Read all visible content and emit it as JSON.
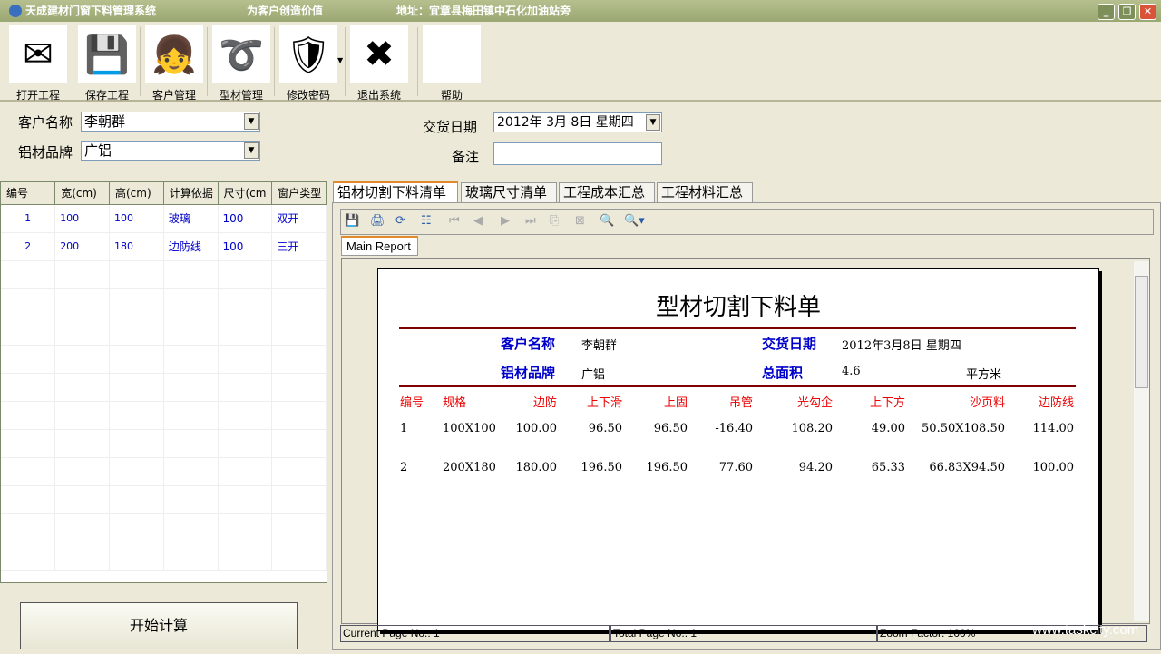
{
  "window": {
    "title": "天成建材门窗下料管理系统",
    "slogan": "为客户创造价值",
    "address": "地址：宜章县梅田镇中石化加油站旁",
    "minimize": "_",
    "restore": "❐",
    "close": "✕"
  },
  "toolbar": [
    {
      "label": "打开工程",
      "icon": "open-project-icon",
      "glyph": "✉"
    },
    {
      "label": "保存工程",
      "icon": "save-floppy-icon",
      "glyph": "💾"
    },
    {
      "label": "客户管理",
      "icon": "customer-avatar-icon",
      "glyph": "👧"
    },
    {
      "label": "型材管理",
      "icon": "profile-knot-icon",
      "glyph": "➰"
    },
    {
      "label": "修改密码",
      "icon": "shield-icon",
      "glyph": "🛡"
    },
    {
      "label": "退出系统",
      "icon": "exit-x-icon",
      "glyph": "✖"
    },
    {
      "label": "帮助",
      "icon": "help-icon",
      "glyph": "help"
    }
  ],
  "form": {
    "customer_label": "客户名称",
    "customer_value": "李朝群",
    "brand_label": "铝材品牌",
    "brand_value": "广铝",
    "date_label": "交货日期",
    "date_value": "2012年  3月  8日  星期四",
    "note_label": "备注",
    "note_value": ""
  },
  "grid": {
    "columns": [
      "编号",
      "宽(cm)",
      "高(cm)",
      "计算依据",
      "尺寸(cm",
      "窗户类型"
    ],
    "rows": [
      [
        "1",
        "100",
        "100",
        "玻璃",
        "100",
        "双开"
      ],
      [
        "2",
        "200",
        "180",
        "边防线",
        "100",
        "三开"
      ]
    ]
  },
  "calc_button": "开始计算",
  "tabs": [
    "铝材切割下料清单",
    "玻璃尺寸清单",
    "工程成本汇总",
    "工程材料汇总"
  ],
  "report_tab": "Main Report",
  "report": {
    "title": "型材切割下料单",
    "customer_label": "客户名称",
    "customer": "李朝群",
    "date_label": "交货日期",
    "date": "2012年3月8日  星期四",
    "brand_label": "铝材品牌",
    "brand": "广铝",
    "area_label": "总面积",
    "area": "4.6",
    "area_unit": "平方米",
    "columns": [
      "编号",
      "规格",
      "边防",
      "上下滑",
      "上固",
      "吊管",
      "光勾企",
      "上下方",
      "沙页料",
      "边防线"
    ],
    "rows": [
      [
        "1",
        "100X100",
        "100.00",
        "96.50",
        "96.50",
        "-16.40",
        "108.20",
        "49.00",
        "50.50X108.50",
        "114.00"
      ],
      [
        "2",
        "200X180",
        "180.00",
        "196.50",
        "196.50",
        "77.60",
        "94.20",
        "65.33",
        "66.83X94.50",
        "100.00"
      ]
    ]
  },
  "status": {
    "current": "Current Page No.: 1",
    "total": "Total Page No.: 1",
    "zoom": "Zoom Factor: 100%"
  },
  "watermark": "www.taskcity.com",
  "colors": {
    "title_bar": "#9aa872",
    "report_rule": "#800000",
    "header_red": "#ee0000",
    "label_blue": "#0000cc"
  }
}
